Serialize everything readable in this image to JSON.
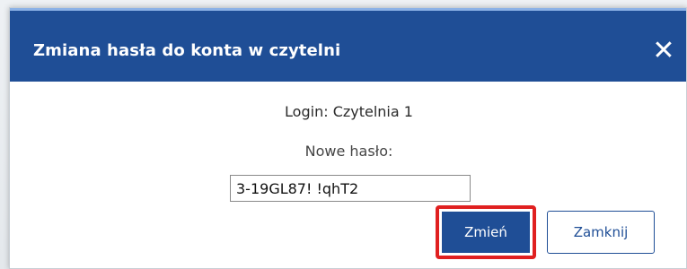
{
  "dialog": {
    "title": "Zmiana hasła do konta w czytelni",
    "close_icon": "close-icon",
    "close_glyph": "✕",
    "login_label": "Login: Czytelnia 1",
    "password_label": "Nowe hasło:",
    "password_value": "3-19GL87! !qhT2",
    "submit_label": "Zmień",
    "close_label": "Zamknij"
  },
  "colors": {
    "header": "#1f4e96",
    "highlight": "#e02020"
  }
}
